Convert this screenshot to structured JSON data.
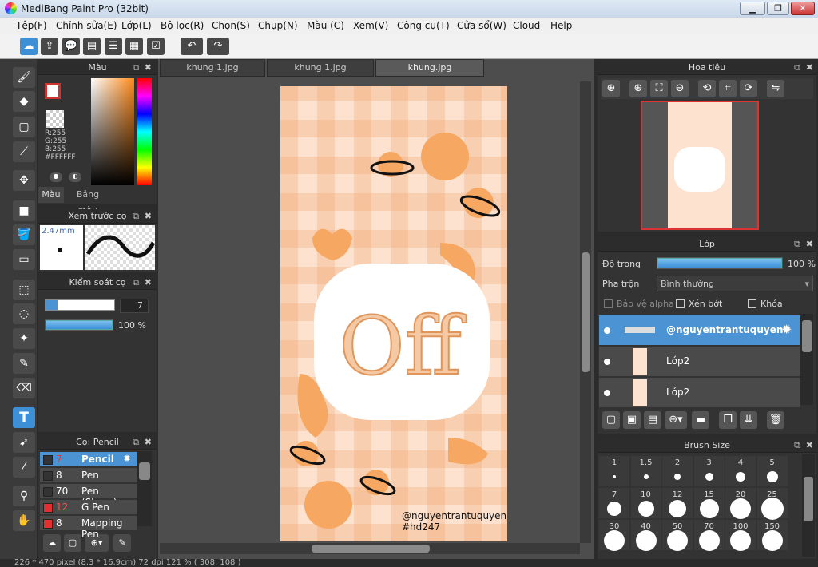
{
  "app": {
    "title": "MediBang Paint Pro (32bit)"
  },
  "menu": [
    "Tệp(F)",
    "Chỉnh sửa(E)",
    "Lớp(L)",
    "Bộ lọc(R)",
    "Chọn(S)",
    "Chụp(N)",
    "Màu (C)",
    "Xem(V)",
    "Công cụ(T)",
    "Cửa sổ(W)",
    "Cloud",
    "Help"
  ],
  "tabs": [
    "khung 1.jpg",
    "khung 1.jpg",
    "khung.jpg"
  ],
  "color_panel": {
    "title": "Màu",
    "r": "R:255",
    "g": "G:255",
    "b": "B:255",
    "hex": "#FFFFFF",
    "tab_color": "Màu",
    "tab_palette": "Bảng màu",
    "primary": "#ffffff",
    "secondary": "#c89ae0"
  },
  "brush_preview": {
    "title": "Xem trước cọ",
    "size": "2.47mm"
  },
  "brush_control": {
    "title": "Kiểm soát cọ",
    "size": "7",
    "opacity": "100 %",
    "opacity_fill": 1.0,
    "size_fill": 0.18
  },
  "brush_list": {
    "title": "Cọ: Pencil",
    "items": [
      {
        "size": "7",
        "name": "Pencil",
        "color": "#333333",
        "selected": true
      },
      {
        "size": "8",
        "name": "Pen",
        "color": "#333333",
        "selected": false
      },
      {
        "size": "70",
        "name": "Pen (Sharp)",
        "color": "#333333",
        "selected": false
      },
      {
        "size": "12",
        "name": "G Pen",
        "color": "#e03030",
        "selected": false
      },
      {
        "size": "8",
        "name": "Mapping Pen",
        "color": "#e03030",
        "selected": false
      }
    ]
  },
  "navigator": {
    "title": "Hoa tiêu"
  },
  "layer_panel": {
    "title": "Lớp",
    "opacity_label": "Độ trong",
    "opacity_value": "100 %",
    "opacity_fill": 1.0,
    "blend_label": "Pha trộn",
    "blend_value": "Bình thường",
    "protect_alpha": "Bảo vệ alpha",
    "clipping": "Xén bớt",
    "lock": "Khóa",
    "layers": [
      {
        "name": "@nguyentrantuquyen",
        "selected": true
      },
      {
        "name": "Lớp2",
        "selected": false
      },
      {
        "name": "Lớp2",
        "selected": false
      }
    ]
  },
  "brush_size": {
    "title": "Brush Size",
    "sizes": [
      "1",
      "1.5",
      "2",
      "3",
      "4",
      "5",
      "7",
      "10",
      "12",
      "15",
      "20",
      "25",
      "30",
      "40",
      "50",
      "70",
      "100",
      "150"
    ]
  },
  "artwork": {
    "text": "Off",
    "credit1": "@nguyentrantuquyen",
    "credit2": "#hd247"
  },
  "status": {
    "text": "226 * 470 pixel   (8.3 * 16.9cm)   72 dpi   121 %   ( 308, 108 )"
  }
}
